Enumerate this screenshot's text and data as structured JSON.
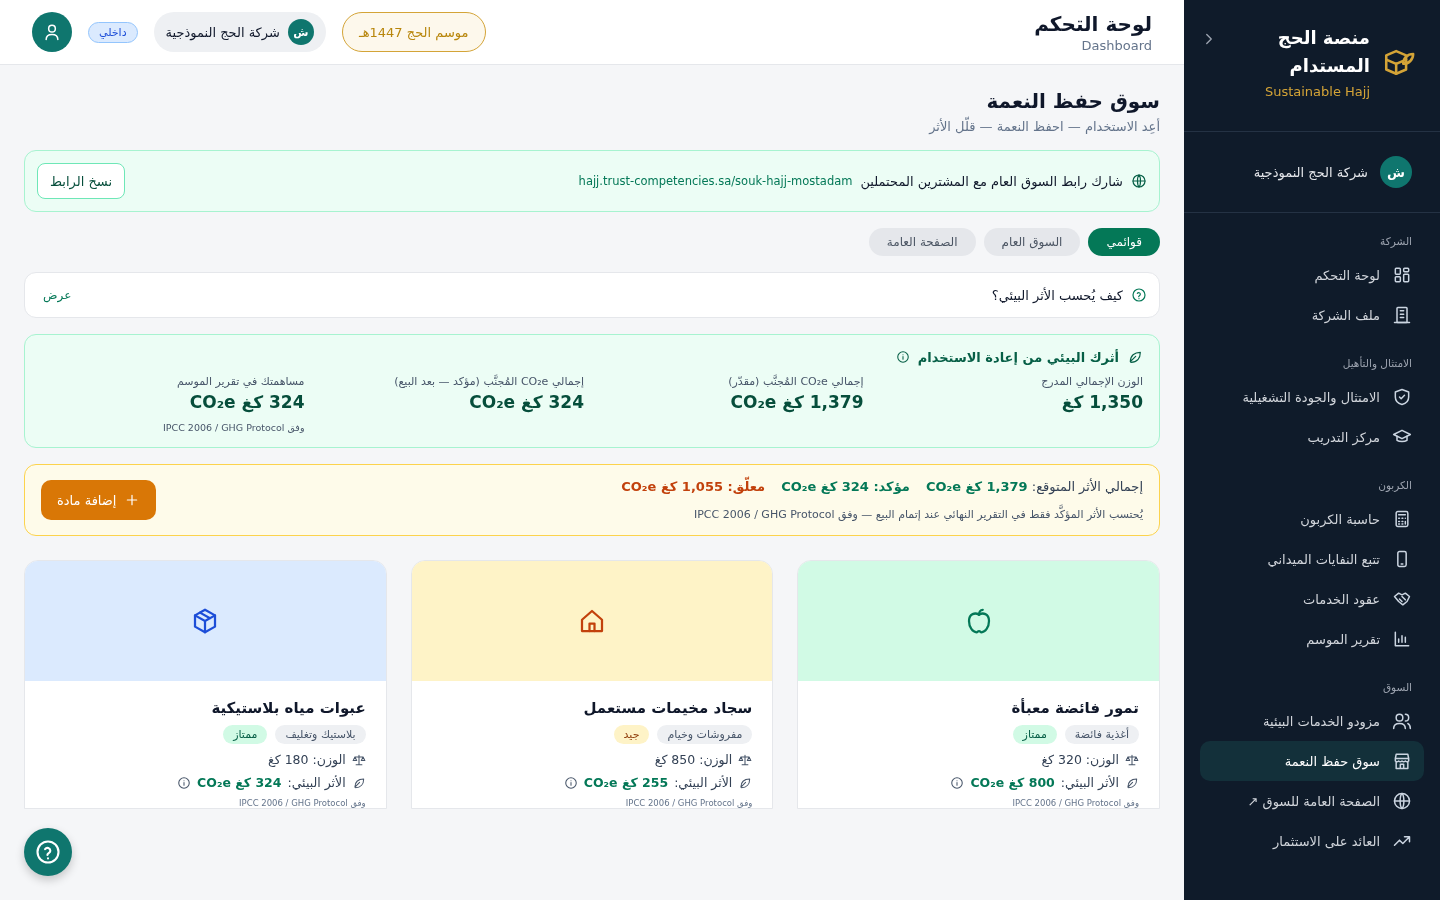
{
  "sidebar": {
    "title": "منصة الحج المستدام",
    "subtitle": "Sustainable Hajj",
    "company": {
      "initial": "ش",
      "name": "شركة الحج النموذجية"
    },
    "sections": [
      {
        "label": "الشركة",
        "items": [
          {
            "kind": "grid",
            "label": "لوحة التحكم",
            "selected": false
          },
          {
            "kind": "building",
            "label": "ملف الشركة",
            "selected": false
          }
        ]
      },
      {
        "label": "الامتثال والتأهيل",
        "items": [
          {
            "kind": "shield",
            "label": "الامتثال والجودة التشغيلية",
            "selected": false
          },
          {
            "kind": "cap",
            "label": "مركز التدريب",
            "selected": false
          }
        ]
      },
      {
        "label": "الكربون",
        "items": [
          {
            "kind": "calc",
            "label": "حاسبة الكربون",
            "selected": false
          },
          {
            "kind": "phone",
            "label": "تتبع النفايات الميداني",
            "selected": false
          },
          {
            "kind": "hands",
            "label": "عقود الخدمات",
            "selected": false
          },
          {
            "kind": "chart",
            "label": "تقرير الموسم",
            "selected": false
          }
        ]
      },
      {
        "label": "السوق",
        "items": [
          {
            "kind": "users",
            "label": "مزودو الخدمات البيئية",
            "selected": false
          },
          {
            "kind": "store",
            "label": "سوق حفظ النعمة",
            "selected": true
          },
          {
            "kind": "globe",
            "label": "الصفحة العامة للسوق ↗",
            "selected": false
          },
          {
            "kind": "trend",
            "label": "العائد على الاستثمار",
            "selected": false
          }
        ]
      }
    ]
  },
  "header": {
    "title": "لوحة التحكم",
    "subtitle": "Dashboard",
    "season": "موسم الحج 1447هـ",
    "company_initial": "ش",
    "company": "شركة الحج النموذجية",
    "role": "داخلي"
  },
  "page": {
    "title": "سوق حفظ النعمة",
    "subtitle": "أعِد الاستخدام — احفظ النعمة — قلّل الأثر"
  },
  "share": {
    "text": "شارك رابط السوق العام مع المشترين المحتملين",
    "url": "hajj.trust-competencies.sa/souk-hajj-mostadam",
    "button": "نسخ الرابط"
  },
  "tabs": [
    {
      "label": "قوائمي",
      "selected": true
    },
    {
      "label": "السوق العام",
      "selected": false
    },
    {
      "label": "الصفحة العامة",
      "selected": false
    }
  ],
  "faq": {
    "question": "كيف يُحسب الأثر البيئي؟",
    "action": "عرض"
  },
  "impact": {
    "title": "أثرك البيئي من إعادة الاستخدام",
    "stats": [
      {
        "label": "الوزن الإجمالي المدرج",
        "value": "1,350 كغ"
      },
      {
        "label": "إجمالي CO₂e المُجنَّب (مقدّر)",
        "value": "1,379 كغ CO₂e"
      },
      {
        "label": "إجمالي CO₂e المُجنَّب (مؤكد — بعد البيع)",
        "value": "324 كغ CO₂e"
      },
      {
        "label": "مساهمتك في تقرير الموسم",
        "value": "324 كغ CO₂e",
        "note": "وفق IPCC 2006 / GHG Protocol"
      }
    ]
  },
  "summary": {
    "expected_label": "إجمالي الأثر المتوقع:",
    "expected": "1,379 كغ CO₂e",
    "confirmed": "مؤكد: 324 كغ CO₂e",
    "pending": "معلّق: 1,055 كغ CO₂e",
    "note": "يُحتسب الأثر المؤكَّد فقط في التقرير النهائي عند إتمام البيع — وفق IPCC 2006 / GHG Protocol",
    "button": "إضافة مادة"
  },
  "listings": [
    {
      "kind": "apple",
      "color": "#d1fae5",
      "title": "تمور فائضة معبأة",
      "category": "أغذية فائضة",
      "grade": {
        "kind": "excellent",
        "label": "ممتاز"
      },
      "weight_label": "الوزن:",
      "weight": "320 كغ",
      "impact_label": "الأثر البيئي:",
      "impact": "800 كغ CO₂e",
      "note": "وفق IPCC 2006 / GHG Protocol"
    },
    {
      "kind": "house",
      "color": "#fef3c7",
      "title": "سجاد مخيمات مستعمل",
      "category": "مفروشات وخيام",
      "grade": {
        "kind": "good",
        "label": "جيد"
      },
      "weight_label": "الوزن:",
      "weight": "850 كغ",
      "impact_label": "الأثر البيئي:",
      "impact": "255 كغ CO₂e",
      "note": "وفق IPCC 2006 / GHG Protocol"
    },
    {
      "kind": "box",
      "color": "#dbeafe",
      "title": "عبوات مياه بلاستيكية",
      "category": "بلاستيك وتغليف",
      "grade": {
        "kind": "excellent",
        "label": "ممتاز"
      },
      "weight_label": "الوزن:",
      "weight": "180 كغ",
      "impact_label": "الأثر البيئي:",
      "impact": "324 كغ CO₂e",
      "note": "وفق IPCC 2006 / GHG Protocol"
    }
  ]
}
